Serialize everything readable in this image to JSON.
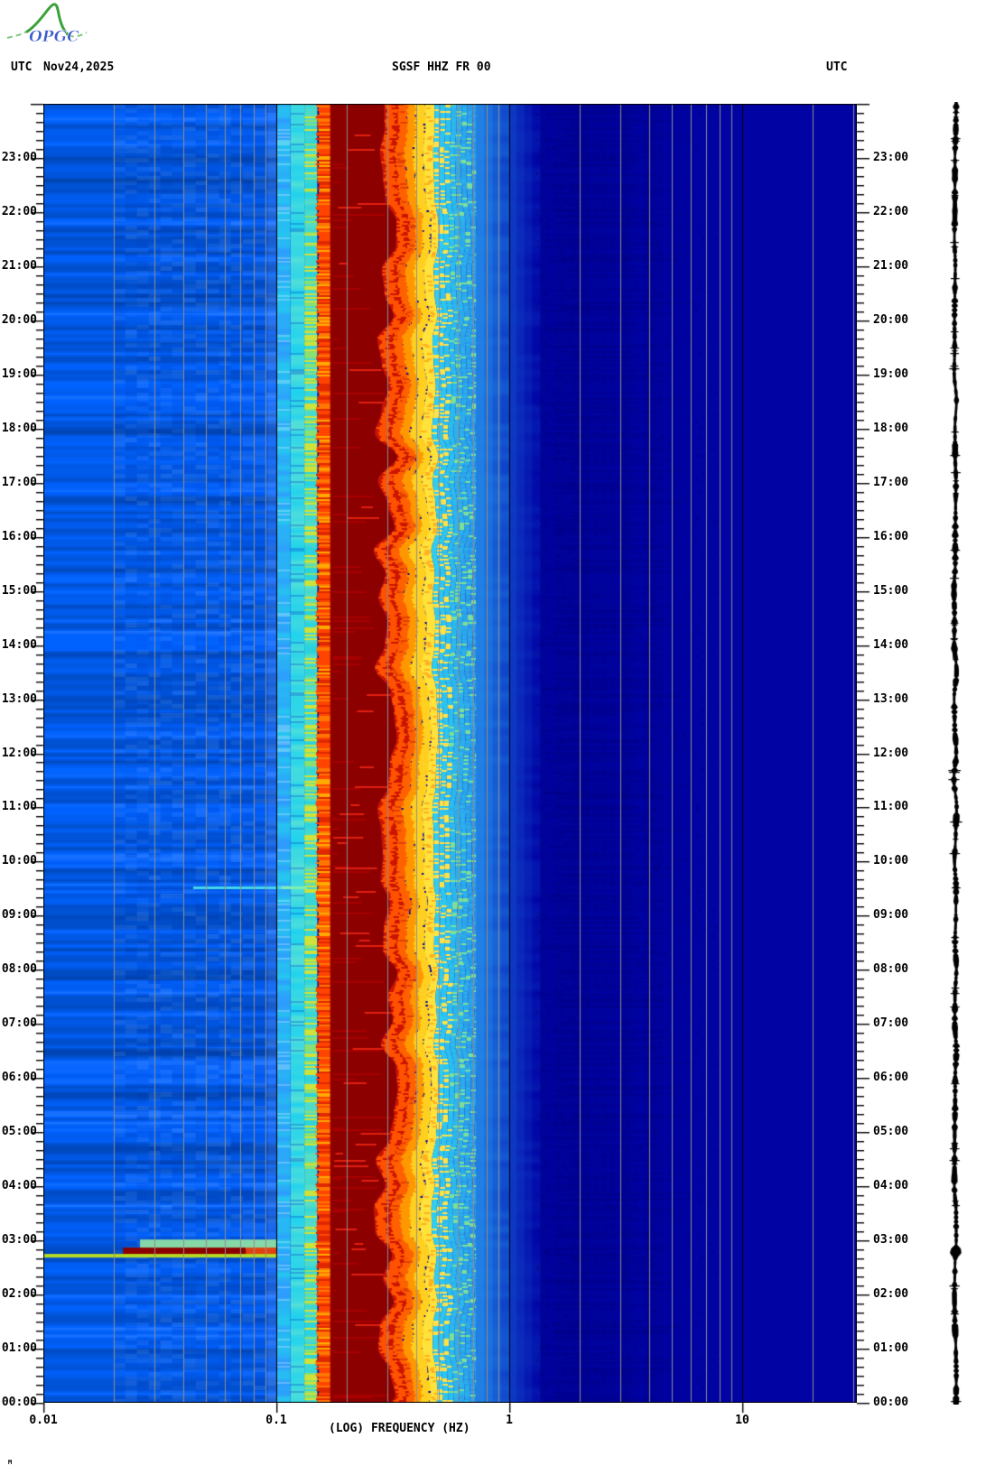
{
  "header": {
    "utc_left": "UTC",
    "date": "Nov24,2025",
    "title": "SGSF HHZ FR 00",
    "utc_right": "UTC",
    "logo_text": "OPGC"
  },
  "corner_mark": "M",
  "chart_data": {
    "type": "heatmap",
    "title": "SGSF HHZ FR 00",
    "subtitle": "24-hour seismic spectrogram, station SGSF channel HHZ network FR location 00",
    "date": "Nov24,2025",
    "xlabel": "(LOG) FREQUENCY (HZ)",
    "x_scale": "log",
    "x_range_hz": [
      0.01,
      31
    ],
    "x_ticks": [
      {
        "value": 0.01,
        "label": "0.01"
      },
      {
        "value": 0.1,
        "label": "0.1"
      },
      {
        "value": 1,
        "label": "1"
      },
      {
        "value": 10,
        "label": "10"
      }
    ],
    "grid_minor_hz": [
      0.02,
      0.03,
      0.04,
      0.05,
      0.06,
      0.07,
      0.08,
      0.09,
      0.2,
      0.3,
      0.4,
      0.5,
      0.6,
      0.7,
      0.8,
      0.9,
      2,
      3,
      4,
      5,
      6,
      7,
      8,
      9,
      20,
      30
    ],
    "grid_major_hz": [
      0.1,
      1,
      10
    ],
    "grid_minor_color": "#8f8f8f",
    "grid_major_color": "#000000",
    "y_axis": {
      "unit": "UTC time",
      "bottom": "00:00",
      "top": "24:00",
      "minor_tick_minutes": 10,
      "hour_labels": [
        "00:00",
        "01:00",
        "02:00",
        "03:00",
        "04:00",
        "05:00",
        "06:00",
        "07:00",
        "08:00",
        "09:00",
        "10:00",
        "11:00",
        "12:00",
        "13:00",
        "14:00",
        "15:00",
        "16:00",
        "17:00",
        "18:00",
        "19:00",
        "20:00",
        "21:00",
        "22:00",
        "23:00"
      ]
    },
    "bands": [
      {
        "f0": 0.01,
        "f1": 0.1,
        "style": "stripes",
        "colors": [
          "#0033dd",
          "#0099ff"
        ],
        "desc": "long-period noise, time-varying blue stripes"
      },
      {
        "f0": 0.1,
        "f1": 0.115,
        "style": "mix",
        "colors": [
          "#2e9cff",
          "#25c8f0"
        ]
      },
      {
        "f0": 0.115,
        "f1": 0.132,
        "style": "solidvar",
        "colors": [
          "#20d2ee",
          "#55e0d8"
        ]
      },
      {
        "f0": 0.132,
        "f1": 0.15,
        "style": "cyan_yellow",
        "colors": [
          "#28d2e0",
          "#cfe23a",
          "#8ae070"
        ]
      },
      {
        "f0": 0.15,
        "f1": 0.175,
        "style": "streak_warm",
        "colors": [
          "#ff4400",
          "#ff7700",
          "#e02800",
          "#ffaa00"
        ]
      },
      {
        "f0": 0.175,
        "f1": 0.295,
        "style": "darkred",
        "colors": [
          "#8c0000",
          "#a80000",
          "#e02010"
        ],
        "desc": "secondary microseism peak"
      },
      {
        "f0": 0.295,
        "f1": 0.345,
        "style": "red_mix",
        "colors": [
          "#cc1400",
          "#ff5200"
        ]
      },
      {
        "f0": 0.345,
        "f1": 0.44,
        "style": "orange_yellow",
        "colors": [
          "#ff6000",
          "#ff9800",
          "#ffd020"
        ]
      },
      {
        "f0": 0.44,
        "f1": 0.48,
        "style": "yellow",
        "colors": [
          "#ffe23a",
          "#ffb020"
        ]
      },
      {
        "f0": 0.48,
        "f1": 0.72,
        "style": "speckle_cyan",
        "colors": [
          "#ffe24a",
          "#7ce09a",
          "#2ecdf2",
          "#2b96e8"
        ]
      },
      {
        "f0": 0.72,
        "f1": 1.0,
        "style": "fade",
        "colors": [
          "#2488e6",
          "#0f46cc"
        ]
      },
      {
        "f0": 1.0,
        "f1": 1.35,
        "style": "fade",
        "colors": [
          "#0f3ec6",
          "#0209a8"
        ]
      },
      {
        "f0": 1.35,
        "f1": 31.0,
        "style": "navy",
        "colors": [
          "#0103a2",
          "#000080"
        ],
        "desc": "quiet high-frequency background"
      }
    ],
    "events": [
      {
        "time_utc": "02:45",
        "hours": 2.75,
        "f_line": [
          0.01,
          0.1
        ],
        "f_body": [
          0.022,
          0.1
        ],
        "line_color": "#b8dc20",
        "body_color": "#8c0000",
        "tail_color": "#e04010",
        "halo_color": "#86d8a8",
        "desc": "broadband transient (earthquake) reaching low frequencies"
      },
      {
        "time_utc": "09:30",
        "hours": 9.54,
        "f": [
          0.044,
          0.135
        ],
        "color": "#45d8e8",
        "bright_color": "#7df0b0",
        "desc": "weak transient, cyan line"
      }
    ],
    "side_trace": {
      "color": "#000000",
      "desc": "24 h vertical seismogram amplitude trace"
    },
    "legend": null
  }
}
